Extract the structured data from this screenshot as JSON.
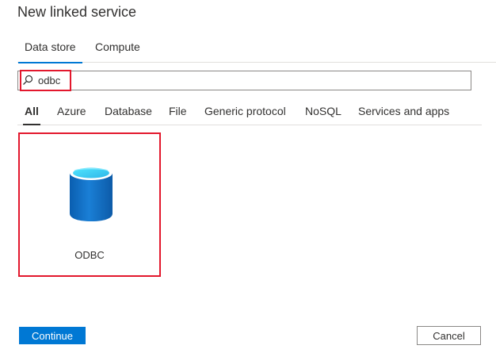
{
  "dialog": {
    "title": "New linked service"
  },
  "top_tabs": [
    {
      "label": "Data store",
      "active": true
    },
    {
      "label": "Compute",
      "active": false
    }
  ],
  "search": {
    "value": "odbc",
    "icon": "search-icon"
  },
  "category_tabs": [
    {
      "label": "All",
      "active": true
    },
    {
      "label": "Azure",
      "active": false
    },
    {
      "label": "Database",
      "active": false
    },
    {
      "label": "File",
      "active": false
    },
    {
      "label": "Generic protocol",
      "active": false
    },
    {
      "label": "NoSQL",
      "active": false
    },
    {
      "label": "Services and apps",
      "active": false
    }
  ],
  "results": [
    {
      "label": "ODBC",
      "icon": "database-icon",
      "selected": true
    }
  ],
  "footer": {
    "continue_label": "Continue",
    "cancel_label": "Cancel"
  },
  "colors": {
    "accent": "#0078d4",
    "highlight": "#e3182d",
    "text": "#323130",
    "border": "#8a8886"
  }
}
